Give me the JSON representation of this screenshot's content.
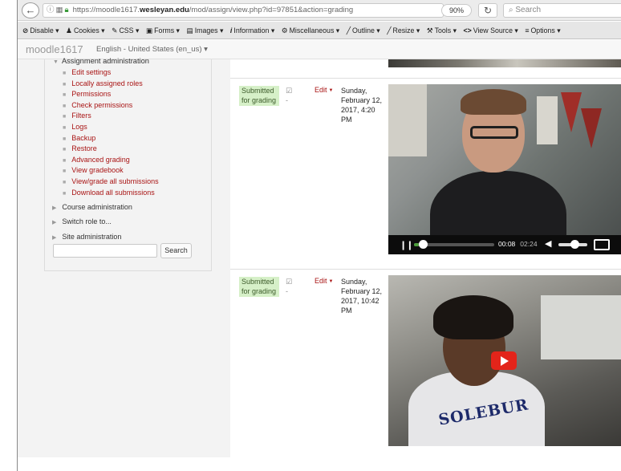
{
  "browser": {
    "url_prefix": "https://moodle1617.",
    "url_domain": "wesleyan.edu",
    "url_suffix": "/mod/assign/view.php?id=97851&action=grading",
    "zoom": "90%",
    "search_placeholder": "Search"
  },
  "devtoolbar": {
    "items": [
      "Disable",
      "Cookies",
      "CSS",
      "Forms",
      "Images",
      "Information",
      "Miscellaneous",
      "Outline",
      "Resize",
      "Tools",
      "View Source",
      "Options"
    ]
  },
  "header": {
    "site_name": "moodle1617",
    "language": "English - United States (en_us)"
  },
  "sidebar": {
    "section_title": "Assignment administration",
    "items": [
      "Edit settings",
      "Locally assigned roles",
      "Permissions",
      "Check permissions",
      "Filters",
      "Logs",
      "Backup",
      "Restore",
      "Advanced grading",
      "View gradebook",
      "View/grade all submissions",
      "Download all submissions"
    ],
    "nodes": [
      "Course administration",
      "Switch role to...",
      "Site administration"
    ],
    "search_button": "Search"
  },
  "submissions": [
    {
      "status": "Submitted for grading",
      "status_line1": "Submitted",
      "status_line2": "for grading",
      "grade": "-",
      "edit": "Edit",
      "date_lines": [
        "Sunday,",
        "February 12,",
        "2017, 4:20",
        "PM"
      ],
      "video": {
        "current_time": "00:08",
        "duration": "02:24",
        "progress": 0.06
      }
    },
    {
      "status": "Submitted for grading",
      "status_line1": "Submitted",
      "status_line2": "for grading",
      "grade": "-",
      "edit": "Edit",
      "date_lines": [
        "Sunday,",
        "February 12,",
        "2017, 10:42",
        "PM"
      ],
      "video": {
        "shirt_text": "SOLEBUR"
      }
    }
  ],
  "colors": {
    "link_red": "#a91515",
    "status_green_bg": "#d6f0c8",
    "play_red": "#e3241a"
  }
}
